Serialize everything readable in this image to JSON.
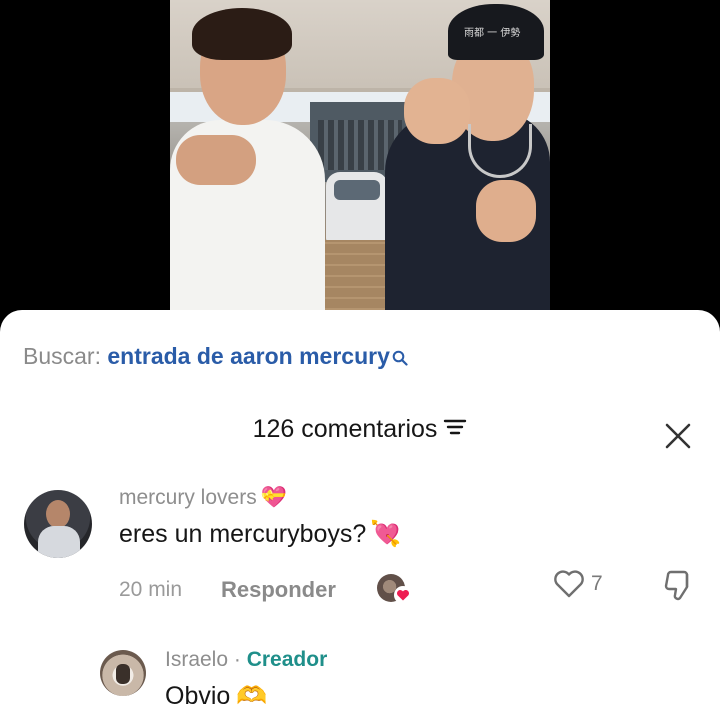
{
  "video": {
    "cap_text": "雨都 一 伊勢"
  },
  "search": {
    "prefix": "Buscar:",
    "query": "entrada de aaron mercury"
  },
  "comments_header": {
    "count_label": "126 comentarios"
  },
  "comment": {
    "username": "mercury lovers",
    "username_emoji": "💝",
    "text": "eres un mercuryboys?",
    "text_emoji": "💘",
    "time": "20 min",
    "reply_label": "Responder",
    "like_count": "7"
  },
  "reply": {
    "username": "Israelo",
    "separator": "·",
    "badge": "Creador",
    "text": "Obvio",
    "text_emoji": "🫶"
  },
  "colors": {
    "search_link": "#2a5ca8",
    "creator_badge": "#1f8f8a",
    "liked_heart": "#ee1d52"
  },
  "icons": [
    "search-icon",
    "filter-icon",
    "close-icon",
    "heart-icon",
    "dislike-icon"
  ]
}
